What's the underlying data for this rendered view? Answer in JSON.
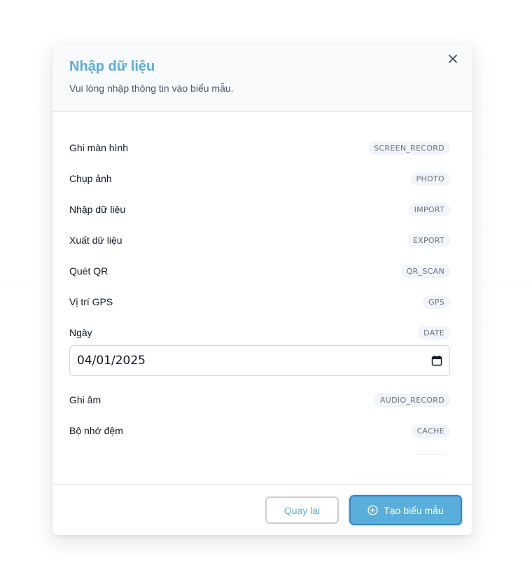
{
  "modal": {
    "title": "Nhập dữ liệu",
    "subtitle": "Vui lòng nhập thông tin vào biểu mẫu.",
    "close_icon": "close-icon"
  },
  "fields": [
    {
      "label": "Ghi màn hình",
      "tag": "SCREEN_RECORD"
    },
    {
      "label": "Chụp ảnh",
      "tag": "PHOTO"
    },
    {
      "label": "Nhập dữ liệu",
      "tag": "IMPORT"
    },
    {
      "label": "Xuất dữ liệu",
      "tag": "EXPORT"
    },
    {
      "label": "Quét QR",
      "tag": "QR_SCAN"
    },
    {
      "label": "Vị trí GPS",
      "tag": "GPS"
    },
    {
      "label": "Ngày",
      "tag": "DATE"
    },
    {
      "label": "Ghi âm",
      "tag": "AUDIO_RECORD"
    },
    {
      "label": "Bộ nhớ đệm",
      "tag": "CACHE"
    }
  ],
  "date_field": {
    "value": "04/01/2025",
    "icon": "calendar-icon"
  },
  "footer": {
    "back_label": "Quay lại",
    "create_label": "Tạo biểu mẫu",
    "create_icon": "plus-circle-icon"
  },
  "colors": {
    "accent": "#5aaedb",
    "accent_border": "#3b82c4",
    "tag_bg": "#f1f5f9"
  }
}
